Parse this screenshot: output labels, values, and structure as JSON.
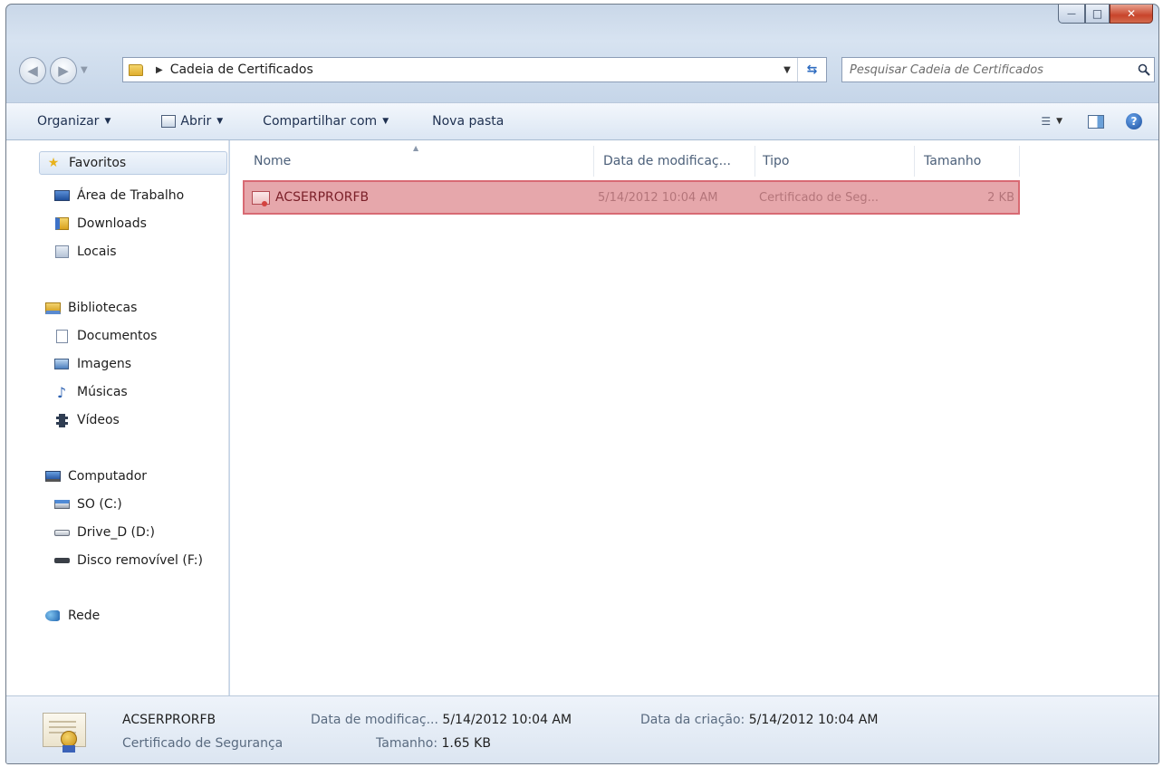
{
  "window": {
    "controls": {
      "minimize": "—",
      "maximize": "□",
      "close": "✕"
    }
  },
  "address": {
    "crumb": "Cadeia de Certificados",
    "search_placeholder": "Pesquisar Cadeia de Certificados"
  },
  "toolbar": {
    "organize": "Organizar",
    "open": "Abrir",
    "share": "Compartilhar com",
    "new_folder": "Nova pasta"
  },
  "nav": {
    "favorites": "Favoritos",
    "desktop": "Área de Trabalho",
    "downloads": "Downloads",
    "places": "Locais",
    "libraries": "Bibliotecas",
    "documents": "Documentos",
    "pictures": "Imagens",
    "music": "Músicas",
    "videos": "Vídeos",
    "computer": "Computador",
    "drive_c": "SO (C:)",
    "drive_d": "Drive_D (D:)",
    "drive_f": "Disco removível (F:)",
    "network": "Rede"
  },
  "columns": {
    "name": "Nome",
    "modified": "Data de modificaç...",
    "type": "Tipo",
    "size": "Tamanho"
  },
  "files": [
    {
      "name": "ACSERPRORFB",
      "modified": "5/14/2012 10:04 AM",
      "type": "Certificado de Seg...",
      "size": "2 KB"
    }
  ],
  "details": {
    "name": "ACSERPRORFB",
    "type": "Certificado de Segurança",
    "modified_label": "Data de modificaç...",
    "modified_value": "5/14/2012 10:04 AM",
    "size_label": "Tamanho:",
    "size_value": "1.65 KB",
    "created_label": "Data da criação:",
    "created_value": "5/14/2012 10:04 AM"
  },
  "colors": {
    "selection_fill": "#e6a7ab",
    "selection_border": "#d86a73",
    "window_chrome": "#c9d7e8"
  }
}
